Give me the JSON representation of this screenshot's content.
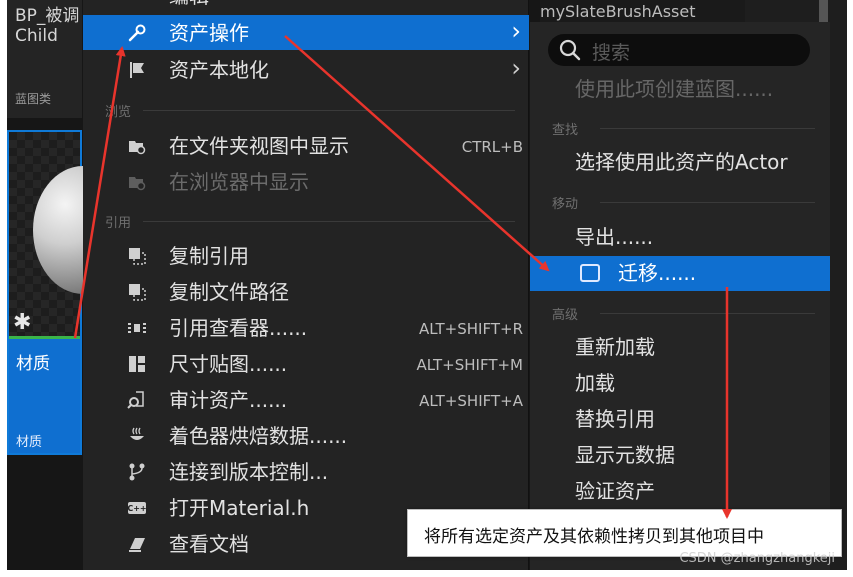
{
  "asset_browser": {
    "top_asset_name": "BP_被调\nChild",
    "top_asset_type": "蓝图类",
    "selected_asset_name": "材质",
    "selected_asset_type": "材质",
    "right_asset_name": "mySlateBrushAsset"
  },
  "context_menu": {
    "top_partial_label": "编辑",
    "items": [
      {
        "label": "资产操作",
        "icon": "wrench-icon",
        "submenu": true,
        "highlighted": true
      },
      {
        "label": "资产本地化",
        "icon": "flag-icon",
        "submenu": true
      }
    ],
    "sections": {
      "browse": "浏览",
      "references": "引用"
    },
    "browse_items": [
      {
        "label": "在文件夹视图中显示",
        "shortcut": "CTRL+B",
        "icon": "folder-search-icon"
      },
      {
        "label": "在浏览器中显示",
        "shortcut": "",
        "icon": "folder-search-icon",
        "disabled": true
      }
    ],
    "reference_items": [
      {
        "label": "复制引用",
        "shortcut": "",
        "icon": "copy-reference-icon"
      },
      {
        "label": "复制文件路径",
        "shortcut": "",
        "icon": "copy-path-icon"
      },
      {
        "label": "引用查看器......",
        "shortcut": "ALT+SHIFT+R",
        "icon": "reference-viewer-icon"
      },
      {
        "label": "尺寸贴图......",
        "shortcut": "ALT+SHIFT+M",
        "icon": "size-map-icon"
      },
      {
        "label": "审计资产......",
        "shortcut": "ALT+SHIFT+A",
        "icon": "audit-icon"
      },
      {
        "label": "着色器烘焙数据......",
        "shortcut": "",
        "icon": "shader-cook-icon"
      },
      {
        "label": "连接到版本控制...",
        "shortcut": "",
        "icon": "source-control-icon"
      },
      {
        "label": "打开Material.h",
        "shortcut": "",
        "icon": "cpp-header-icon"
      },
      {
        "label": "查看文档",
        "shortcut": "",
        "icon": "documentation-icon"
      }
    ]
  },
  "submenu": {
    "search_placeholder": "搜索",
    "create_blueprint": "使用此项创建蓝图......",
    "sections": {
      "find": "查找",
      "move": "移动",
      "advanced": "高级"
    },
    "find_items": [
      "选择使用此资产的Actor"
    ],
    "move_items": [
      "导出......",
      "迁移......"
    ],
    "advanced_items": [
      "重新加载",
      "加载",
      "替换引用",
      "显示元数据",
      "验证资产"
    ]
  },
  "tooltip": {
    "text": "将所有选定资产及其依赖性拷贝到其他项目中"
  },
  "watermark": "CSDN @zhangzhangkeji",
  "colors": {
    "highlight": "#0f6fd0",
    "menu_bg": "#232323",
    "annotation_arrow": "#e8342c"
  }
}
